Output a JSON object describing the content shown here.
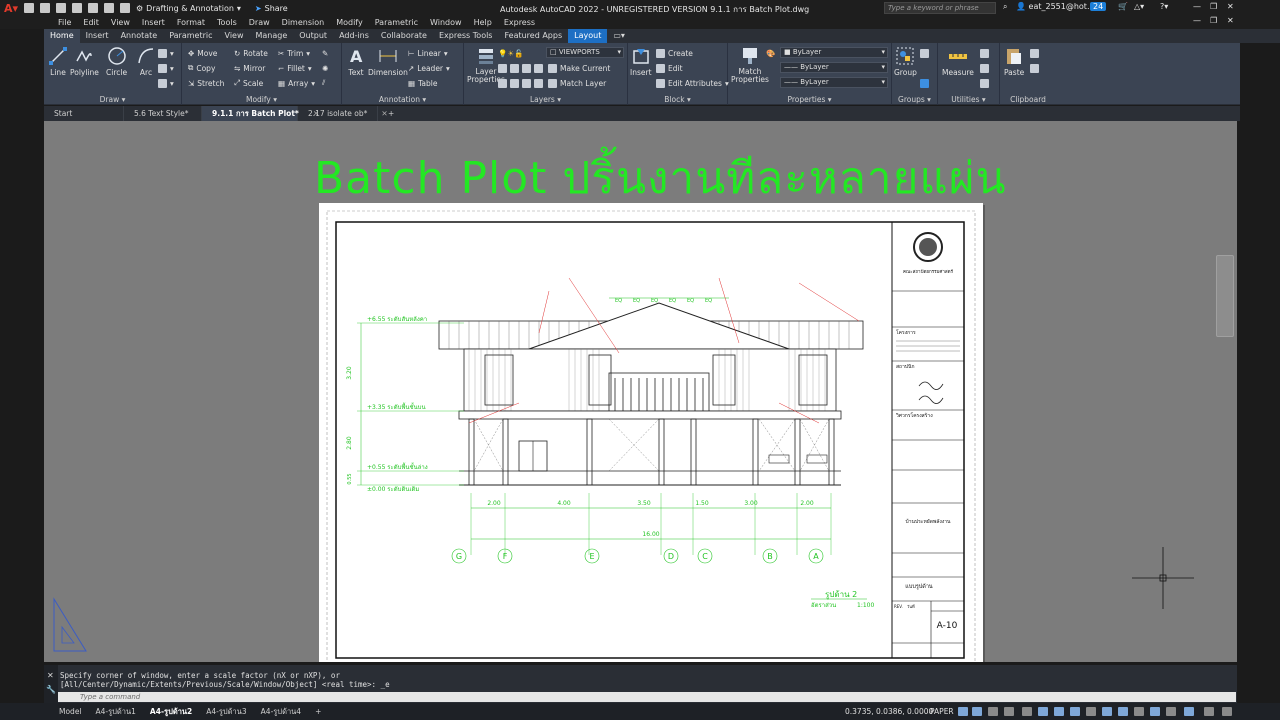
{
  "titlebar": {
    "workspace": "Drafting & Annotation",
    "share": "Share",
    "title": "Autodesk AutoCAD 2022 - UNREGISTERED VERSION    9.1.1 การ Batch Plot.dwg",
    "search_placeholder": "Type a keyword or phrase",
    "user": "eat_2551@hot...",
    "notif_count": "24"
  },
  "menubar": [
    "File",
    "Edit",
    "View",
    "Insert",
    "Format",
    "Tools",
    "Draw",
    "Dimension",
    "Modify",
    "Parametric",
    "Window",
    "Help",
    "Express"
  ],
  "ribbon_tabs": [
    {
      "label": "Home",
      "active": true
    },
    {
      "label": "Insert"
    },
    {
      "label": "Annotate"
    },
    {
      "label": "Parametric"
    },
    {
      "label": "View"
    },
    {
      "label": "Manage"
    },
    {
      "label": "Output"
    },
    {
      "label": "Add-ins"
    },
    {
      "label": "Collaborate"
    },
    {
      "label": "Express Tools"
    },
    {
      "label": "Featured Apps"
    },
    {
      "label": "Layout",
      "highlight": true
    }
  ],
  "ribbon": {
    "draw": {
      "title": "Draw",
      "line": "Line",
      "polyline": "Polyline",
      "circle": "Circle",
      "arc": "Arc"
    },
    "modify": {
      "title": "Modify",
      "move": "Move",
      "rotate": "Rotate",
      "trim": "Trim",
      "copy": "Copy",
      "mirror": "Mirror",
      "fillet": "Fillet",
      "stretch": "Stretch",
      "scale": "Scale",
      "array": "Array"
    },
    "annotation": {
      "title": "Annotation",
      "text": "Text",
      "dimension": "Dimension",
      "linear": "Linear",
      "leader": "Leader",
      "table": "Table"
    },
    "layers": {
      "title": "Layers",
      "layer_properties": "Layer Properties",
      "layer_name": "VIEWPORTS",
      "make_current": "Make Current",
      "match_layer": "Match Layer"
    },
    "block": {
      "title": "Block",
      "insert": "Insert",
      "create": "Create",
      "edit": "Edit",
      "edit_attributes": "Edit Attributes"
    },
    "properties": {
      "title": "Properties",
      "match_properties": "Match Properties",
      "color": "ByLayer",
      "lineweight": "ByLayer",
      "linetype": "ByLayer"
    },
    "groups": {
      "title": "Groups",
      "group": "Group"
    },
    "utilities": {
      "title": "Utilities",
      "measure": "Measure"
    },
    "clipboard": {
      "title": "Clipboard",
      "paste": "Paste"
    }
  },
  "doc_tabs": [
    {
      "label": "Start"
    },
    {
      "label": "5.6 Text Style*"
    },
    {
      "label": "9.1.1 การ Batch Plot*",
      "active": true
    },
    {
      "label": "2.17 isolate ob*"
    }
  ],
  "canvas": {
    "heading": "Batch Plot ปริ้นงานทีละหลายแผ่น",
    "elevation_levels": [
      "+6.55 ระดับสันหลังคา",
      "+3.35 ระดับพื้นชั้นบน",
      "+0.55 ระดับพื้นชั้นล่าง",
      "±0.00 ระดับดินเดิม"
    ],
    "vertical_dims": [
      "3.20",
      "2.80",
      "0.55"
    ],
    "horizontal_dims": [
      "2.00",
      "4.00",
      "3.50",
      "1.50",
      "3.00",
      "2.00"
    ],
    "total_dim": "16.00",
    "grid_labels": [
      "G",
      "F",
      "E",
      "D",
      "C",
      "B",
      "A"
    ],
    "eq_labels": [
      "EQ",
      "EQ",
      "EQ",
      "EQ",
      "EQ",
      "EQ"
    ],
    "drawing_title": "รูปด้าน 2",
    "drawing_scale_label": "อัตราส่วน",
    "drawing_scale": "1:100",
    "titleblock": {
      "org": "คณะสถาปัตยกรรมศาสตร์",
      "sheet_no": "A-10",
      "project_label": "โครงการ",
      "architect_label": "สถาปนิก",
      "engineer_label": "วิศวกรโครงสร้าง",
      "building_label": "บ้านประหยัดพลังงาน",
      "drawing_label": "แบบรูปด้าน",
      "rev": "REV.",
      "date": "วันที่"
    }
  },
  "command": {
    "line1": "Specify corner of window, enter a scale factor (nX or nXP), or",
    "line2": "[All/Center/Dynamic/Extents/Previous/Scale/Window/Object] <real time>: _e",
    "placeholder": "Type a command"
  },
  "layout_tabs": [
    {
      "label": "Model"
    },
    {
      "label": "A4-รูปด้าน1"
    },
    {
      "label": "A4-รูปด้าน2",
      "active": true
    },
    {
      "label": "A4-รูปด้าน3"
    },
    {
      "label": "A4-รูปด้าน4"
    }
  ],
  "status": {
    "coords": "0.3735, 0.0386, 0.0000",
    "space": "PAPER"
  }
}
